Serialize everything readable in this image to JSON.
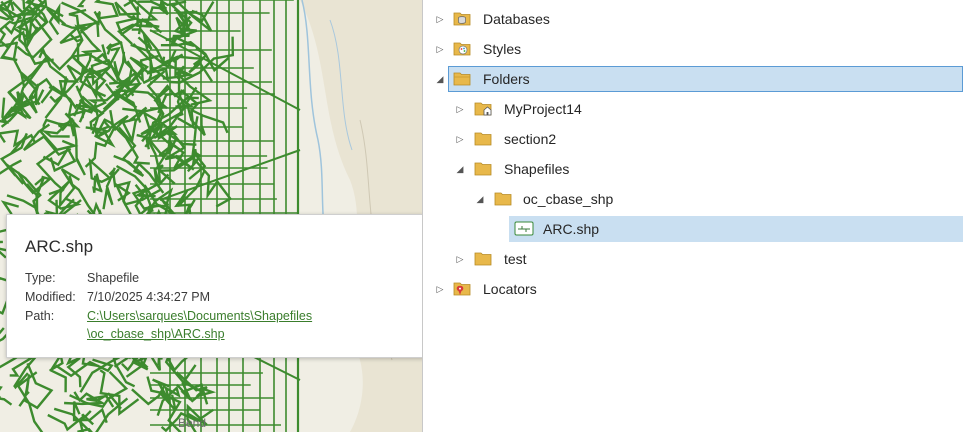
{
  "map": {
    "place_label": "Bend",
    "colors": {
      "base": "#f0eee4",
      "lines": "#3d8b2e",
      "water": "#a9c8dd",
      "terrain": "#e3ddc8"
    }
  },
  "tooltip": {
    "title": "ARC.shp",
    "type_label": "Type:",
    "type_value": "Shapefile",
    "modified_label": "Modified:",
    "modified_value": "7/10/2025 4:34:27 PM",
    "path_label": "Path:",
    "path_line1": "C:\\Users\\sarques\\Documents\\Shapefiles",
    "path_line2": "\\oc_cbase_shp\\ARC.shp"
  },
  "catalog": {
    "items": [
      {
        "label": "Databases",
        "icon": "database-folder-icon",
        "state": "collapsed"
      },
      {
        "label": "Styles",
        "icon": "styles-folder-icon",
        "state": "collapsed"
      },
      {
        "label": "Folders",
        "icon": "folders-icon",
        "state": "expanded",
        "selected": true
      },
      {
        "label": "MyProject14",
        "icon": "home-folder-icon",
        "state": "collapsed"
      },
      {
        "label": "section2",
        "icon": "folder-icon",
        "state": "collapsed"
      },
      {
        "label": "Shapefiles",
        "icon": "folder-icon",
        "state": "expanded"
      },
      {
        "label": "oc_cbase_shp",
        "icon": "folder-icon",
        "state": "expanded"
      },
      {
        "label": "ARC.shp",
        "icon": "line-shapefile-icon",
        "state": "leaf",
        "selected": true
      },
      {
        "label": "test",
        "icon": "folder-icon",
        "state": "collapsed"
      },
      {
        "label": "Locators",
        "icon": "locators-icon",
        "state": "collapsed"
      }
    ],
    "colors": {
      "selection": "#c9dff1",
      "selection_border": "#5b9bd5",
      "folder": "#e8b84a"
    }
  }
}
